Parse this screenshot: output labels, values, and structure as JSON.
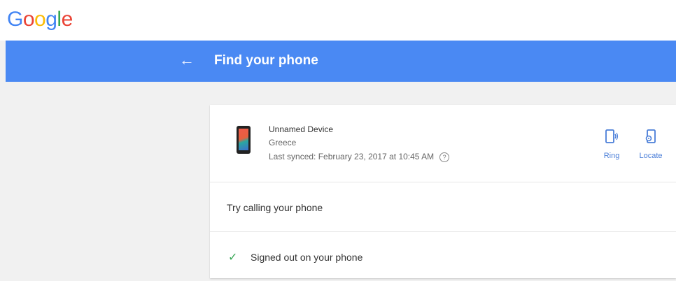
{
  "logo": {
    "letters": [
      {
        "char": "G",
        "color": "#4285f4"
      },
      {
        "char": "o",
        "color": "#ea4335"
      },
      {
        "char": "o",
        "color": "#fbbc05"
      },
      {
        "char": "g",
        "color": "#4285f4"
      },
      {
        "char": "l",
        "color": "#34a853"
      },
      {
        "char": "e",
        "color": "#ea4335"
      }
    ]
  },
  "header": {
    "back_icon": "←",
    "title": "Find your phone"
  },
  "device": {
    "name": "Unnamed Device",
    "location": "Greece",
    "last_synced": "Last synced: February 23, 2017 at 10:45 AM",
    "help_icon": "?"
  },
  "actions": {
    "ring_label": "Ring",
    "locate_label": "Locate"
  },
  "rows": {
    "try_calling": "Try calling your phone",
    "signed_out": "Signed out on your phone",
    "check_icon": "✓"
  }
}
